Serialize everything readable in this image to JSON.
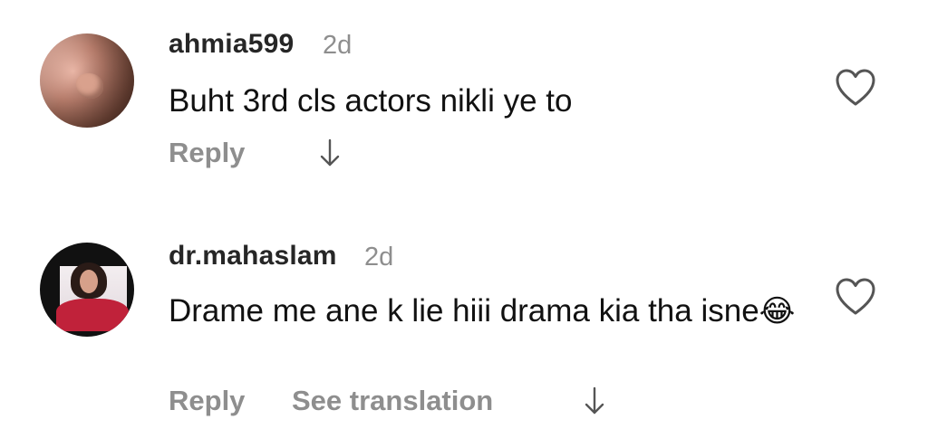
{
  "comments": [
    {
      "username": "ahmia599",
      "time": "2d",
      "text": "Buht 3rd cls actors nikli ye to",
      "reply_label": "Reply"
    },
    {
      "username": "dr.mahaslam",
      "time": "2d",
      "text": "Drame me ane k lie hiii drama kia tha isne",
      "emoji": "😂",
      "reply_label": "Reply",
      "translate_label": "See translation"
    }
  ],
  "icons": {
    "like": "heart-outline-icon",
    "more": "arrow-down-icon"
  },
  "colors": {
    "username": "#262626",
    "meta": "#8e8e8e",
    "text": "#111111",
    "icon": "#555555"
  }
}
